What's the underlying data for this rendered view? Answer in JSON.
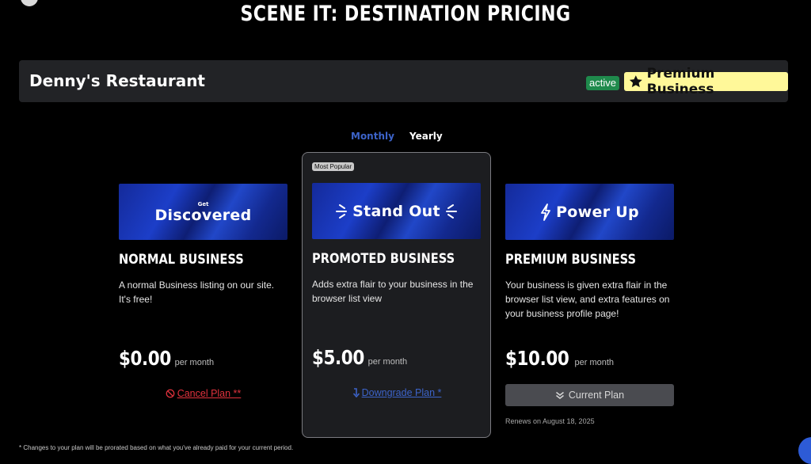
{
  "page": {
    "title": "SCENE IT: DESTINATION PRICING"
  },
  "business": {
    "name": "Denny's Restaurant",
    "status_badge": "active",
    "plan_badge": "Premium Business",
    "plan_badge_icon": "star-icon"
  },
  "billing_toggle": {
    "monthly": "Monthly",
    "yearly": "Yearly",
    "selected": "Monthly"
  },
  "plans": [
    {
      "banner_small": "Get",
      "banner_text": "Discovered",
      "name": "NORMAL BUSINESS",
      "description": "A normal Business listing on our site. It's free!",
      "price": "$0.00",
      "period": "per month",
      "action": "Cancel Plan **",
      "action_icon": "ban-icon"
    },
    {
      "tag": "Most Popular",
      "banner_text": "Stand Out",
      "name": "PROMOTED BUSINESS",
      "description": "Adds extra flair to your business in the browser list view",
      "price": "$5.00",
      "period": "per month",
      "action": "Downgrade Plan *",
      "action_icon": "arrow-down-icon"
    },
    {
      "banner_text": "Power Up",
      "banner_icon": "lightning-icon",
      "name": "PREMIUM BUSINESS",
      "description": "Your business is given extra flair in the browser list view, and extra features on your business profile page!",
      "price": "$10.00",
      "period": "per month",
      "action": "Current Plan",
      "action_icon": "double-check-icon",
      "renews": "Renews on August 18, 2025"
    }
  ],
  "footnote": "* Changes to your plan will be prorated based on what you've already paid for your current period.",
  "colors": {
    "background": "#000000",
    "panel": "#222326",
    "accent_blue": "#3c63c8",
    "danger": "#e2323d",
    "active_green": "#1f8a4c",
    "premium_yellow": "#fff899"
  }
}
